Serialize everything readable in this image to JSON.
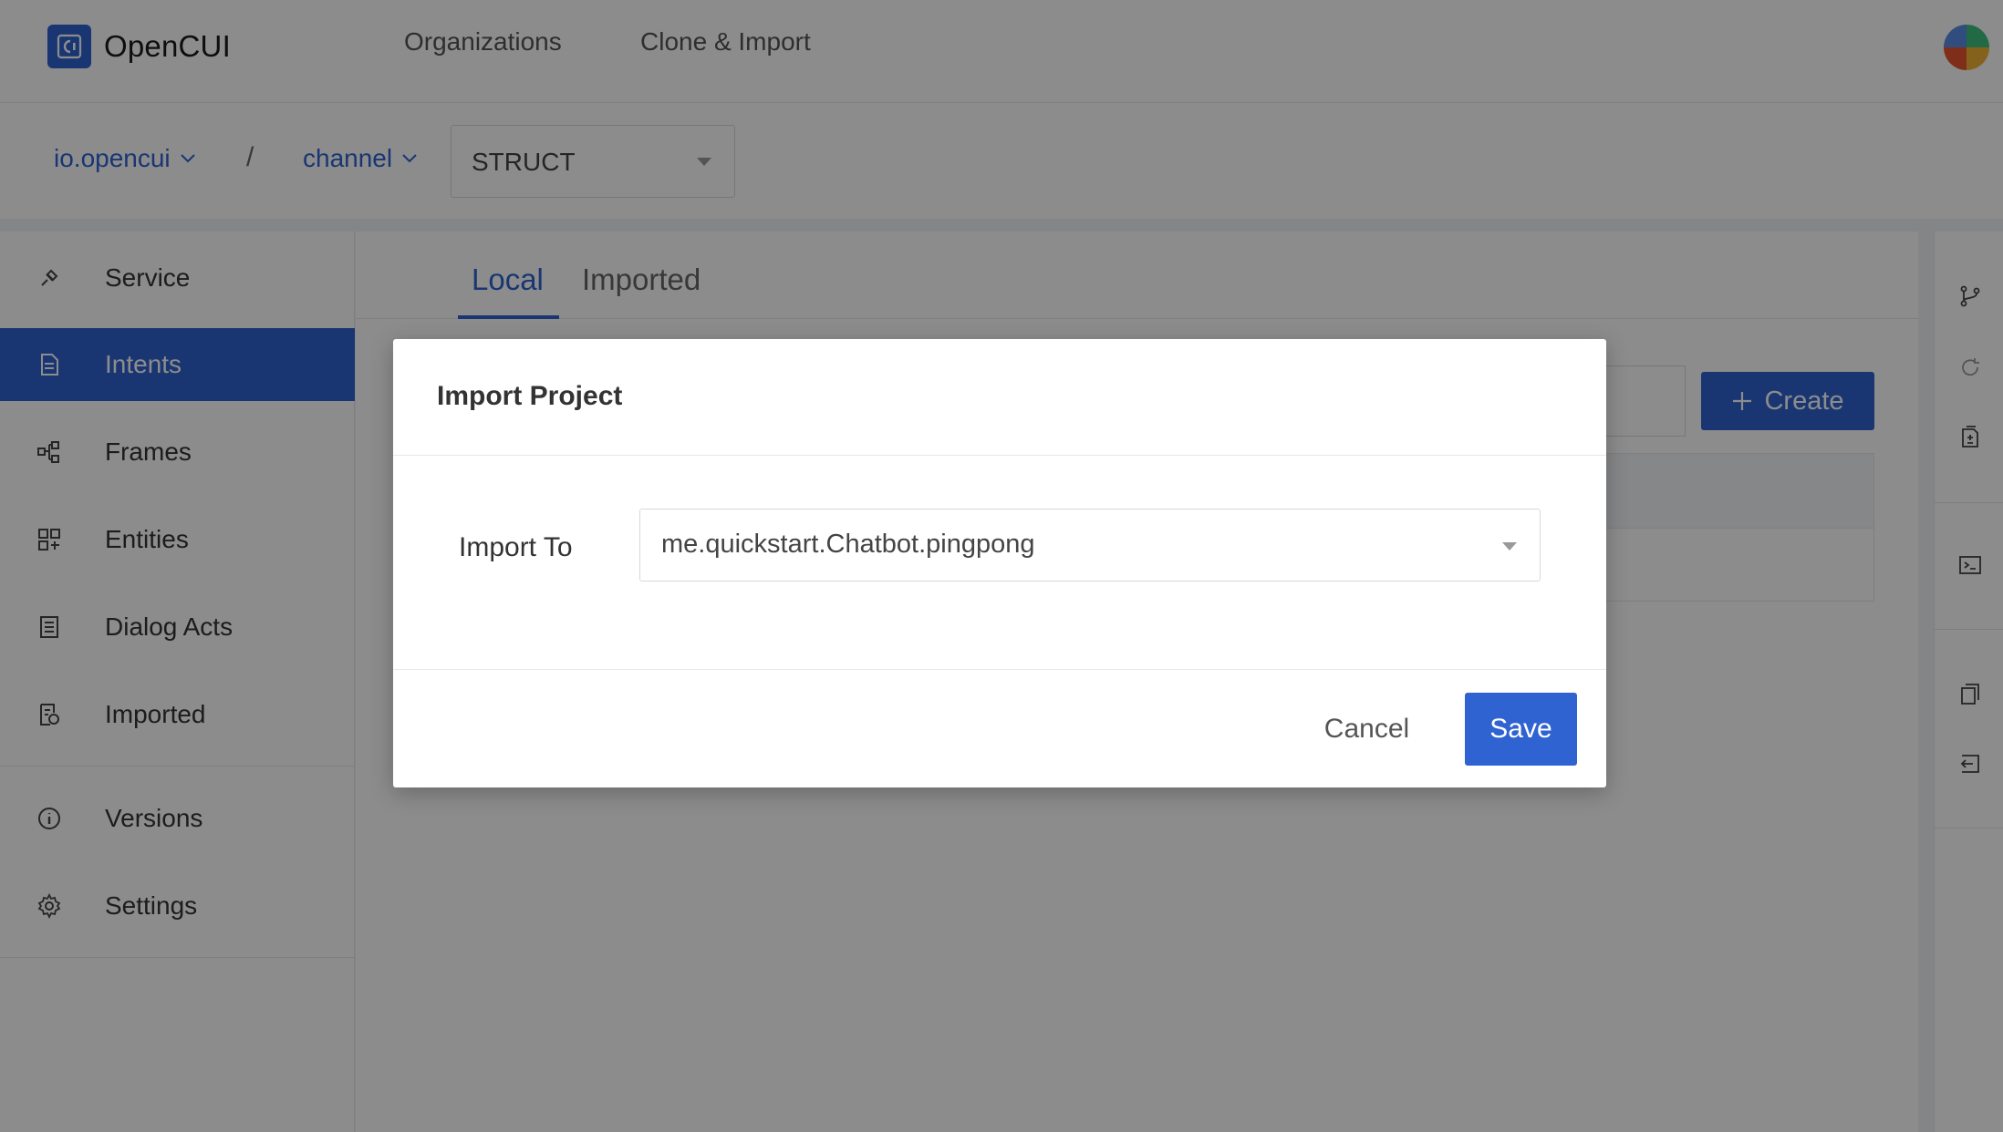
{
  "app": {
    "name": "OpenCUI"
  },
  "topnav": {
    "organizations": "Organizations",
    "clone_import": "Clone & Import"
  },
  "breadcrumb": {
    "org": "io.opencui",
    "separator": "/",
    "project": "channel",
    "type_select": "STRUCT"
  },
  "sidebar": {
    "items": [
      {
        "label": "Service",
        "icon": "service-icon"
      },
      {
        "label": "Intents",
        "icon": "document-icon",
        "active": true
      },
      {
        "label": "Frames",
        "icon": "frames-icon"
      },
      {
        "label": "Entities",
        "icon": "entities-icon"
      },
      {
        "label": "Dialog Acts",
        "icon": "dialog-acts-icon"
      },
      {
        "label": "Imported",
        "icon": "imported-icon"
      },
      {
        "label": "Versions",
        "icon": "info-icon"
      },
      {
        "label": "Settings",
        "icon": "gear-icon"
      }
    ]
  },
  "tabs": {
    "local": "Local",
    "imported": "Imported"
  },
  "toolbar": {
    "create_label": "Create"
  },
  "modal": {
    "title": "Import Project",
    "field_label": "Import To",
    "field_value": "me.quickstart.Chatbot.pingpong",
    "cancel_label": "Cancel",
    "save_label": "Save"
  },
  "colors": {
    "accent": "#2f63d2",
    "overlay": "rgba(0,0,0,0.45)"
  }
}
